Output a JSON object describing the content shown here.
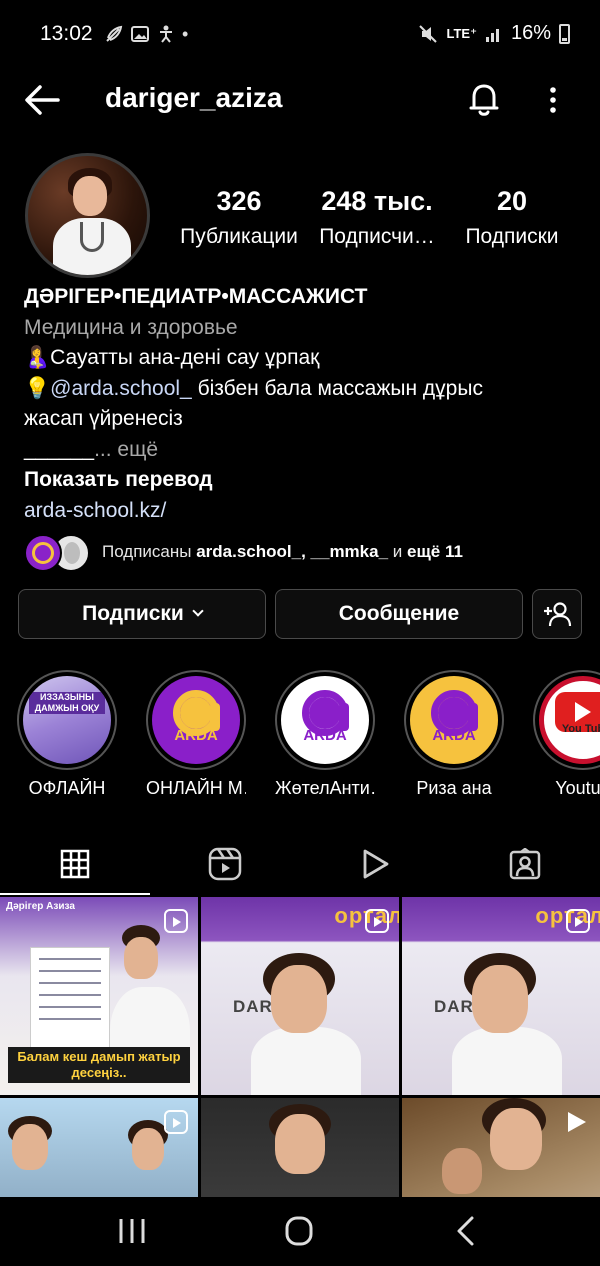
{
  "status_bar": {
    "time": "13:02",
    "network": "LTE⁺",
    "battery": "16%"
  },
  "header": {
    "username": "dariger_aziza"
  },
  "profile": {
    "stats": {
      "posts_value": "326",
      "posts_label": "Публикации",
      "followers_value": "248 тыс.",
      "followers_label": "Подписчи…",
      "following_value": "20",
      "following_label": "Подписки"
    },
    "name": "ДӘРІГЕР•ПЕДИАТР•МАССАЖИСТ",
    "category": "Медицина и здоровье",
    "bio_line1": "🤱Сауатты ана-дені сау ұрпақ",
    "bio_line2_emoji": "💡",
    "bio_mention": "@arda.school_",
    "bio_line2_rest": " бізбен бала массажын дұрыс",
    "bio_line3": "жасап үйренесіз",
    "bio_line4_underline": "______",
    "bio_more": "... ещё",
    "show_translation": "Показать перевод",
    "link": "arda-school.kz/"
  },
  "followed_by": {
    "prefix": "Подписаны ",
    "names": "arda.school_, __mmka_",
    "connector": " и ",
    "rest": "ещё 11"
  },
  "buttons": {
    "following": "Подписки",
    "message": "Сообщение"
  },
  "highlights": [
    {
      "label": "ОФЛАЙН",
      "photo_text": "ИЗЗАЗЫНЫ ДАМЖЫН ОҚУ"
    },
    {
      "label": "ОНЛАЙН М…",
      "logo_text": "ARDA"
    },
    {
      "label": "ЖөтелАнти…",
      "logo_text": "ARDA"
    },
    {
      "label": "Риза ана",
      "logo_text": "ARDA"
    },
    {
      "label": "Youtub",
      "logo_text": "You Tub"
    }
  ],
  "grid": {
    "post1_name": "Дәрігер Азиза",
    "post1_caption": "Балам кеш дамып жатыр десеңіз..",
    "post2_banner": "ортал",
    "post2_brand": "DARIGER",
    "post3_banner": "ортал",
    "post3_brand": "DARIGER"
  },
  "colors": {
    "background": "#000000",
    "text": "#ffffff",
    "muted": "#a8a8a8",
    "link": "#d4e0f8",
    "arda_purple": "#8a1fc9",
    "arda_yellow": "#f6c23e"
  }
}
